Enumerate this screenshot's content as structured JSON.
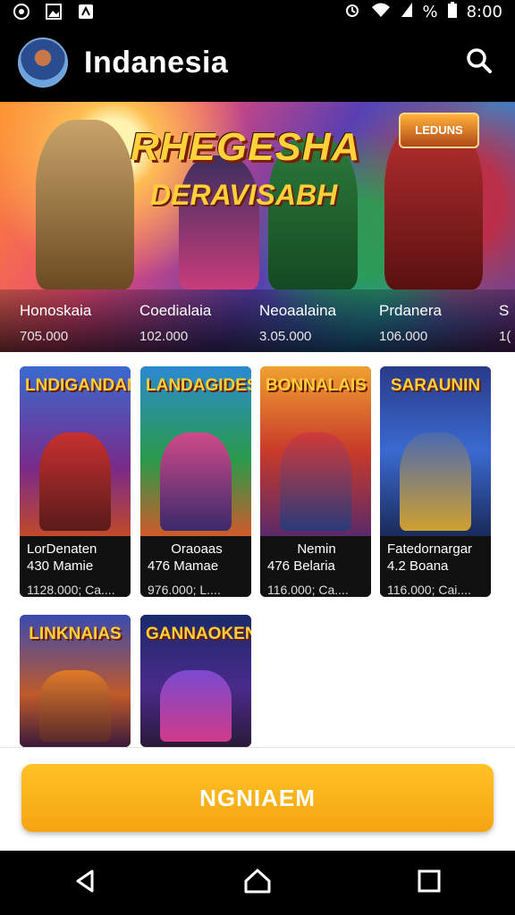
{
  "status_bar": {
    "left_icons": [
      "settings-icon",
      "image-icon",
      "notification-icon"
    ],
    "battery_percent": "%",
    "time": "8:00"
  },
  "app_bar": {
    "title": "Indanesia",
    "avatar": "avatar-icon",
    "search_icon": "search-icon"
  },
  "hero": {
    "title": "RHEGESHA",
    "subtitle": "DERAVISABH",
    "badge": "LEDUNS",
    "items": [
      {
        "name": "Honoskaia",
        "count": "705.000"
      },
      {
        "name": "Coedialaia",
        "count": "102.000"
      },
      {
        "name": "Neoaalaina",
        "count": "3.05.000"
      },
      {
        "name": "Prdanera",
        "count": "106.000"
      },
      {
        "name": "S",
        "count": "1("
      }
    ]
  },
  "cards": [
    {
      "art_title": "LNDIGANDANI",
      "name": "LorDenaten",
      "sub": "430 Mamie",
      "meta": "1128.000; Ca...."
    },
    {
      "art_title": "LANDAGIDES",
      "name": "Oraoaas",
      "sub": "476 Mamae",
      "meta": "976.000; L...."
    },
    {
      "art_title": "BONNALAIS",
      "name": "Nemin",
      "sub": "476 Belaria",
      "meta": "116.000; Ca...."
    },
    {
      "art_title": "SARAUNIN",
      "name": "Fatedornargar",
      "sub": "4.2 Boana",
      "meta": "116.000; Cai...."
    },
    {
      "art_title": "LINKNAIAS",
      "name": "",
      "sub": "",
      "meta": ""
    },
    {
      "art_title": "GANNAOKEN",
      "name": "",
      "sub": "",
      "meta": ""
    }
  ],
  "action_button": {
    "label": "NGNIAEM"
  },
  "colors": {
    "accent": "#f7ae14",
    "background": "#000000",
    "content_bg": "#ffffff"
  },
  "nav_bar": {
    "back_icon": "back-icon",
    "home_icon": "home-icon",
    "recents_icon": "recents-icon"
  }
}
